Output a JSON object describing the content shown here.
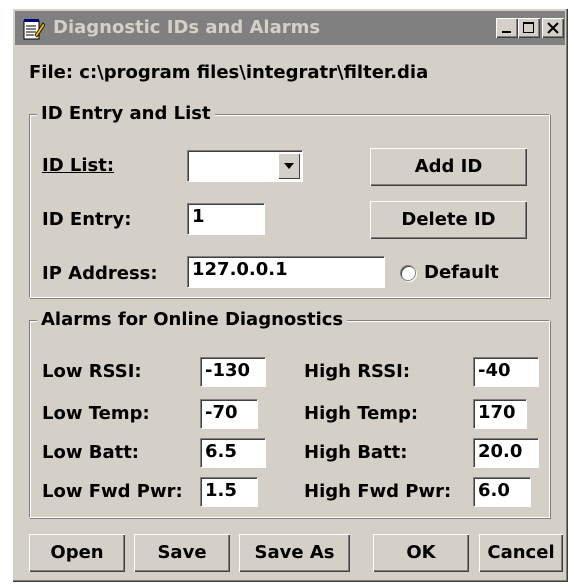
{
  "window": {
    "title": "Diagnostic IDs and Alarms",
    "minimize": "_",
    "maximize": "□",
    "close": "X"
  },
  "file": {
    "label": "File: c:\\program files\\integratr\\filter.dia"
  },
  "id_group": {
    "title": "ID Entry and List",
    "id_list_label": "ID List:",
    "id_list_value": "",
    "id_entry_label": "ID Entry:",
    "id_entry_value": "1",
    "ip_label": "IP Address:",
    "ip_value": "127.0.0.1",
    "default_label": "Default",
    "add_id": "Add ID",
    "delete_id": "Delete ID"
  },
  "alarm_group": {
    "title": "Alarms for Online Diagnostics",
    "low_rssi_label": "Low RSSI:",
    "low_rssi_value": "-130",
    "high_rssi_label": "High RSSI:",
    "high_rssi_value": "-40",
    "low_temp_label": "Low Temp:",
    "low_temp_value": "-70",
    "high_temp_label": "High Temp:",
    "high_temp_value": "170",
    "low_batt_label": "Low Batt:",
    "low_batt_value": "6.5",
    "high_batt_label": "High Batt:",
    "high_batt_value": "20.0",
    "low_fwd_label": "Low Fwd Pwr:",
    "low_fwd_value": "1.5",
    "high_fwd_label": "High Fwd Pwr:",
    "high_fwd_value": "6.0"
  },
  "buttons": {
    "open": "Open",
    "save": "Save",
    "save_as": "Save As",
    "ok": "OK",
    "cancel": "Cancel"
  },
  "colors": {
    "face": "#d4d0c8",
    "titlebar_inactive": "#808080",
    "field": "#ffffff"
  }
}
